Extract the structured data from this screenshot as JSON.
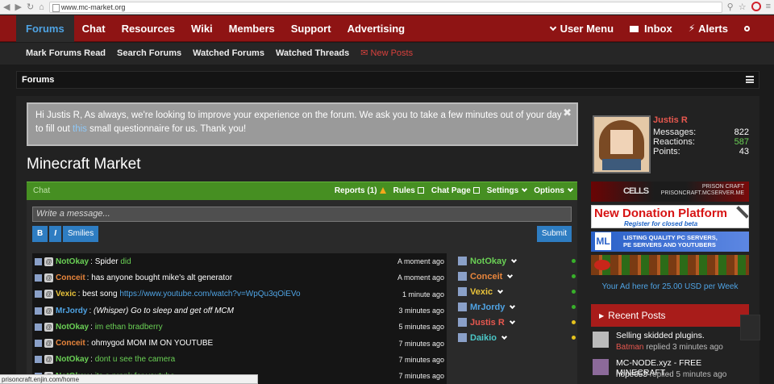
{
  "browser": {
    "url": "www.mc-market.org",
    "status_url": "prisoncraft.enjin.com/home"
  },
  "nav": {
    "tabs": [
      "Forums",
      "Chat",
      "Resources",
      "Wiki",
      "Members",
      "Support",
      "Advertising"
    ],
    "user_menu": "User Menu",
    "inbox": "Inbox",
    "alerts": "Alerts"
  },
  "subnav": {
    "items": [
      "Mark Forums Read",
      "Search Forums",
      "Watched Forums",
      "Watched Threads"
    ],
    "new_posts": "New Posts"
  },
  "breadcrumb": "Forums",
  "notice": {
    "text_before": "Hi Justis R, As always, we're looking to improve your experience on the forum. We ask you to take a few minutes out of your day to fill out ",
    "link": "this",
    "text_after": " small questionnaire for us. Thank you!",
    "close": "✖"
  },
  "page_title": "Minecraft Market",
  "chat": {
    "label": "Chat",
    "reports": "Reports (1)",
    "rules": "Rules",
    "chat_page": "Chat Page",
    "settings": "Settings",
    "options": "Options",
    "placeholder": "Write a message...",
    "bold": "B",
    "italic": "I",
    "smilies": "Smilies",
    "submit": "Submit",
    "messages": [
      {
        "user": "NotOkay",
        "color": "#6ad055",
        "text": "Spider",
        "extra": "did",
        "time": "A moment ago"
      },
      {
        "user": "Conceit",
        "color": "#e8853c",
        "text": "has anyone bought mike's alt generator",
        "extra": "",
        "time": "A moment ago"
      },
      {
        "user": "Vexic",
        "color": "#e9c33a",
        "text": "best song",
        "extra": "https://www.youtube.com/watch?v=WpQu3qOiEVo",
        "time": "1 minute ago"
      },
      {
        "user": "MrJordy",
        "color": "#4fa3e3",
        "text": "(Whisper) Go to sleep and get off MCM",
        "extra": "",
        "time": "3 minutes ago"
      },
      {
        "user": "NotOkay",
        "color": "#6ad055",
        "text": "",
        "extra": "im ethan bradberry",
        "time": "5 minutes ago"
      },
      {
        "user": "Conceit",
        "color": "#e8853c",
        "text": "ohmygod MOM IM ON YOUTUBE",
        "extra": "",
        "time": "7 minutes ago"
      },
      {
        "user": "NotOkay",
        "color": "#6ad055",
        "text": "",
        "extra": "dont u see the camera",
        "time": "7 minutes ago"
      },
      {
        "user": "NotOkay",
        "color": "#6ad055",
        "text": "",
        "extra": "its a prank for youtube",
        "time": "7 minutes ago"
      }
    ],
    "users": [
      {
        "name": "NotOkay",
        "color": "#6ad055",
        "dot": "#38b12a"
      },
      {
        "name": "Conceit",
        "color": "#e8853c",
        "dot": "#38b12a"
      },
      {
        "name": "Vexic",
        "color": "#e9c33a",
        "dot": "#38b12a"
      },
      {
        "name": "MrJordy",
        "color": "#4fa3e3",
        "dot": "#38b12a"
      },
      {
        "name": "Justis R",
        "color": "#e8584f",
        "dot": "#e5c21d"
      },
      {
        "name": "Daikio",
        "color": "#4bc7c7",
        "dot": "#e5c21d"
      }
    ]
  },
  "profile": {
    "name": "Justis R",
    "messages_label": "Messages:",
    "messages": "822",
    "reactions_label": "Reactions:",
    "reactions": "587",
    "points_label": "Points:",
    "points": "43"
  },
  "ads": {
    "ad1_left": "CELLS",
    "ad1_right": "PRISON CRAFT",
    "ad1_url": "PRISONCRAFT.MCSERVER.ME",
    "ad2_title": "New Donation Platform",
    "ad2_sub": "Register for closed beta",
    "ad3_logo": "ML",
    "ad3_line1": "LISTING QUALITY PC SERVERS,",
    "ad3_line2": "PE SERVERS AND YOUTUBERS",
    "your_ad": "Your Ad here for 25.00 USD per Week"
  },
  "recent": {
    "title": "Recent Posts",
    "posts": [
      {
        "title": "Selling skidded plugins.",
        "user": "Batman",
        "meta": "replied 3 minutes ago",
        "user_color": "red"
      },
      {
        "title": "MC-NODE.xyz - FREE MINECRAFT...",
        "user": "hope653",
        "meta": "replied 5 minutes ago",
        "user_color": "white"
      }
    ]
  }
}
